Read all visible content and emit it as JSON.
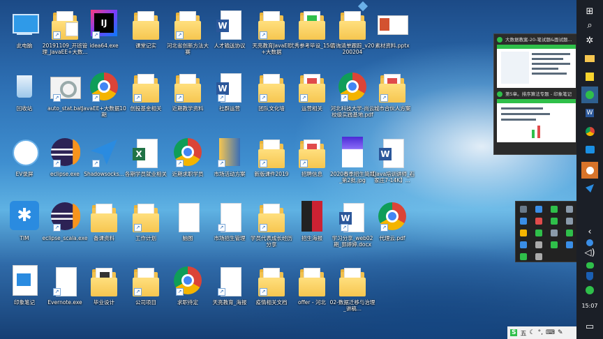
{
  "desktop": {
    "icons": [
      {
        "label": "此电脑"
      },
      {
        "label": "20191109_开班管理_JavaEE+大数..."
      },
      {
        "label": "idea64.exe"
      },
      {
        "label": "课堂记实"
      },
      {
        "label": "河北省创新方法大赛"
      },
      {
        "label": "人才输送协议"
      },
      {
        "label": "天亮教育JavaEE+大数据"
      },
      {
        "label": "优秀参考毕设_15级"
      },
      {
        "label": "咨询清单跟踪_v20200204"
      },
      {
        "label": "素材资料.pptx"
      },
      {
        "label": "回收站"
      },
      {
        "label": "auto_stat.bat"
      },
      {
        "label": "JavaEE+大数据10期"
      },
      {
        "label": "创投基金相关"
      },
      {
        "label": "近期教学资料"
      },
      {
        "label": "社群运营"
      },
      {
        "label": "团队文化墙"
      },
      {
        "label": "运营相关"
      },
      {
        "label": "河北科技大学-尚云校级实践基地.pdf"
      },
      {
        "label": "城市合伙人方案"
      },
      {
        "label": "EV录屏"
      },
      {
        "label": "eclipse.exe"
      },
      {
        "label": "Shadowsocks..."
      },
      {
        "label": "各期学员就业相关"
      },
      {
        "label": "近期求职学员"
      },
      {
        "label": "市场活动方案"
      },
      {
        "label": "新版课件2019"
      },
      {
        "label": "招聘信息"
      },
      {
        "label": "2020春季招生简章_第2批.jpg"
      },
      {
        "label": "【Java培训讲师_石家庄7-14K】..."
      },
      {
        "label": "TIM"
      },
      {
        "label": "eclipse_scala.exe"
      },
      {
        "label": "备课资料"
      },
      {
        "label": "工作计划"
      },
      {
        "label": "脑图"
      },
      {
        "label": "市场招生管理"
      },
      {
        "label": "学员代表成长经历分享"
      },
      {
        "label": "招生海报"
      },
      {
        "label": "学习分享_web02期_郭婷婷.docx"
      },
      {
        "label": "代理云.pdf"
      },
      {
        "label": "印象笔记"
      },
      {
        "label": "Evernote.exe"
      },
      {
        "label": "毕业设计"
      },
      {
        "label": "公司项目"
      },
      {
        "label": "求职待定"
      },
      {
        "label": "天亮教育_海报"
      },
      {
        "label": "疫情相关文档"
      },
      {
        "label": "offer - 河北"
      },
      {
        "label": "02-数据迁移与治理_讲稿..."
      }
    ]
  },
  "taskbar_flyout": {
    "items": [
      {
        "title": "大数据教案-20-笔试题&面试题..."
      },
      {
        "title": "第5章。排序算法专题 - 印象笔记"
      }
    ]
  },
  "ime": {
    "label": "五"
  },
  "clock": {
    "time": "15:07"
  },
  "colors": {
    "taskbar": "#1b1f27",
    "accent": "#d8742a",
    "folder": "#f6c650"
  }
}
